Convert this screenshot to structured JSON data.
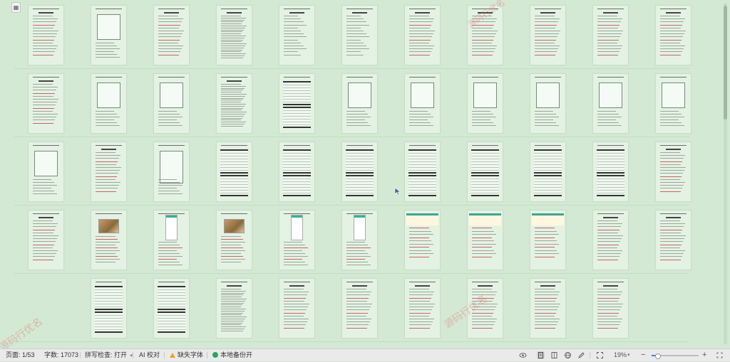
{
  "status_bar": {
    "page_label": "页面: 1/53",
    "word_count": "字数: 17073",
    "spell_check": "拼写检查: 打开",
    "ai_check": "AI 校对",
    "missing_fonts": "缺失字体",
    "backup": "本地备份开",
    "zoom": "19%",
    "zoom_fraction": 0.19
  },
  "watermark_text": "源码行优名",
  "icons": {
    "nav": "grid-icon",
    "view": [
      "eye-icon",
      "page-view-icon",
      "outline-view-icon",
      "web-view-icon",
      "pen-icon",
      "fullscreen-icon"
    ],
    "zoom_out": "minus-icon",
    "zoom_in": "plus-icon"
  },
  "colors": {
    "canvas": "#d4e9d3",
    "page": "#e4f2e3",
    "accent": "#3d7bf0",
    "warning": "#f0a020",
    "ok": "#26a65b"
  },
  "document": {
    "total_pages": 53,
    "current_page": 1
  }
}
